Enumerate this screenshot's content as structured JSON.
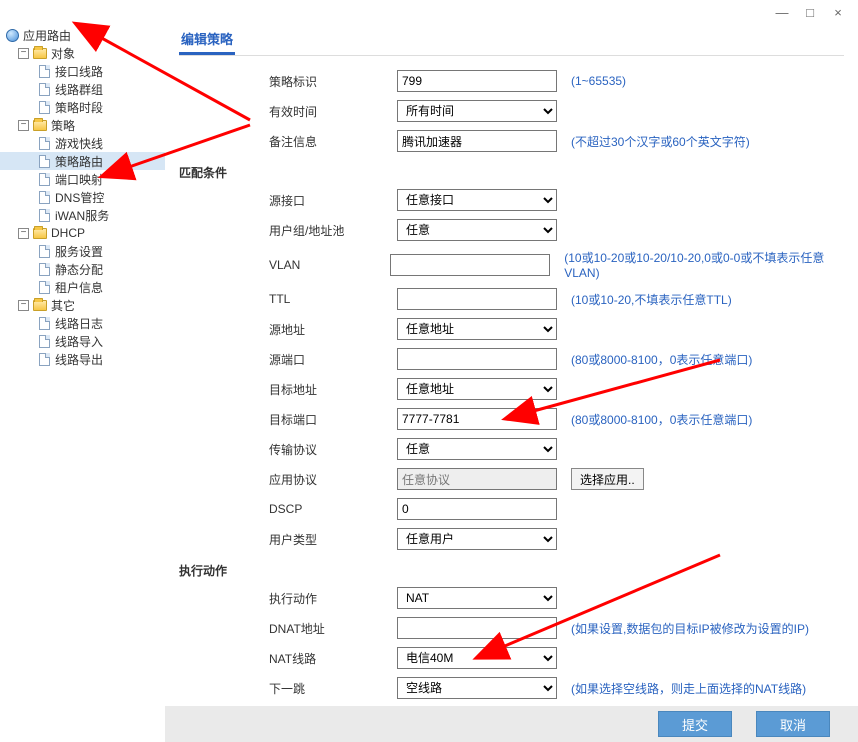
{
  "window": {
    "min": "—",
    "max": "□",
    "close": "×"
  },
  "sidebar": {
    "root": "应用路由",
    "groups": [
      {
        "label": "对象",
        "items": [
          "接口线路",
          "线路群组",
          "策略时段"
        ]
      },
      {
        "label": "策略",
        "items": [
          "游戏快线",
          "策略路由",
          "端口映射",
          "DNS管控",
          "iWAN服务"
        ]
      },
      {
        "label": "DHCP",
        "items": [
          "服务设置",
          "静态分配",
          "租户信息"
        ]
      },
      {
        "label": "其它",
        "items": [
          "线路日志",
          "线路导入",
          "线路导出"
        ]
      }
    ]
  },
  "tab": {
    "label": "编辑策略"
  },
  "labels": {
    "policy_id": "策略标识",
    "valid_time": "有效时间",
    "remark": "备注信息",
    "match": "匹配条件",
    "src_if": "源接口",
    "ug": "用户组/地址池",
    "vlan": "VLAN",
    "ttl": "TTL",
    "src_addr": "源地址",
    "src_port": "源端口",
    "dst_addr": "目标地址",
    "dst_port": "目标端口",
    "proto": "传输协议",
    "app": "应用协议",
    "dscp": "DSCP",
    "user_type": "用户类型",
    "exec": "执行动作",
    "exec_action": "执行动作",
    "dnat": "DNAT地址",
    "nat_line": "NAT线路",
    "next_hop": "下一跳"
  },
  "values": {
    "policy_id": "799",
    "valid_time": "所有时间",
    "remark": "腾讯加速器",
    "src_if": "任意接口",
    "ug": "任意",
    "vlan": "",
    "ttl": "",
    "src_addr": "任意地址",
    "src_port": "",
    "dst_addr": "任意地址",
    "dst_port": "7777-7781",
    "proto": "任意",
    "app": "任意协议",
    "dscp": "0",
    "user_type": "任意用户",
    "exec_action": "NAT",
    "dnat": "",
    "nat_line": "电信40M",
    "next_hop": "空线路"
  },
  "hints": {
    "policy_id": "(1~65535)",
    "remark": "(不超过30个汉字或60个英文字符)",
    "vlan": "(10或10-20或10-20/10-20,0或0-0或不填表示任意VLAN)",
    "ttl": "(10或10-20,不填表示任意TTL)",
    "src_port": "(80或8000-8100，0表示任意端口)",
    "dst_port": "(80或8000-8100，0表示任意端口)",
    "dnat": "(如果设置,数据包的目标IP被修改为设置的IP)",
    "next_hop": "(如果选择空线路，则走上面选择的NAT线路)"
  },
  "buttons": {
    "select_app": "选择应用..",
    "submit": "提交",
    "cancel": "取消"
  }
}
